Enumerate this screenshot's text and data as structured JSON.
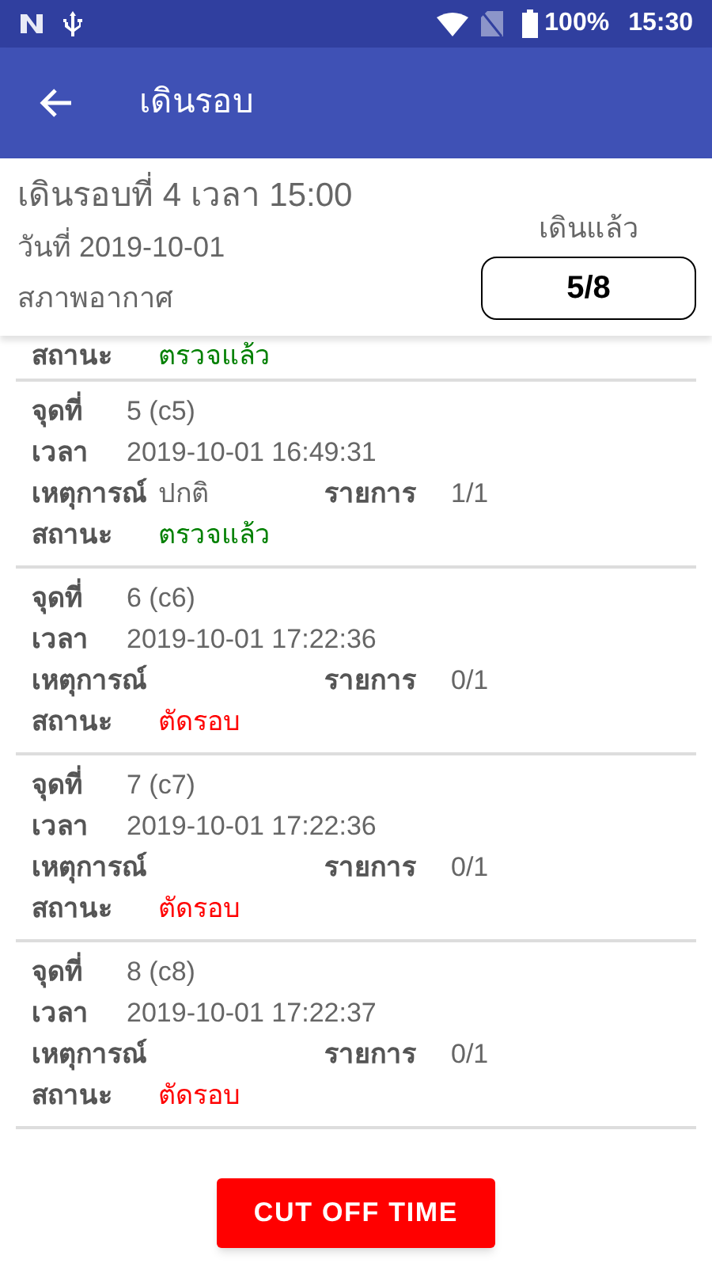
{
  "status_bar": {
    "battery": "100%",
    "time": "15:30"
  },
  "app_bar": {
    "title": "เดินรอบ"
  },
  "summary": {
    "round": "เดินรอบที่ 4 เวลา 15:00",
    "date": "วันที่ 2019-10-01",
    "weather": "สภาพอากาศ",
    "walked_label": "เดินแล้ว",
    "walked": "5/8"
  },
  "points": [
    {
      "status_label": "สถานะ",
      "status": "ตรวจแล้ว",
      "kind": "done"
    },
    {
      "point_label": "จุดที่",
      "point": "5 (c5)",
      "time_label": "เวลา",
      "time": "2019-10-01 16:49:31",
      "event_label": "เหตุการณ์",
      "event": "ปกติ",
      "items_label": "รายการ",
      "items": "1/1",
      "status_label": "สถานะ",
      "status": "ตรวจแล้ว",
      "kind": "done"
    },
    {
      "point_label": "จุดที่",
      "point": "6 (c6)",
      "time_label": "เวลา",
      "time": "2019-10-01 17:22:36",
      "event_label": "เหตุการณ์",
      "items_label": "รายการ",
      "items": "0/1",
      "status_label": "สถานะ",
      "status": "ตัดรอบ",
      "kind": "cut"
    },
    {
      "point_label": "จุดที่",
      "point": "7 (c7)",
      "time_label": "เวลา",
      "time": "2019-10-01 17:22:36",
      "event_label": "เหตุการณ์",
      "items_label": "รายการ",
      "items": "0/1",
      "status_label": "สถานะ",
      "status": "ตัดรอบ",
      "kind": "cut"
    },
    {
      "point_label": "จุดที่",
      "point": "8 (c8)",
      "time_label": "เวลา",
      "time": "2019-10-01 17:22:37",
      "event_label": "เหตุการณ์",
      "items_label": "รายการ",
      "items": "0/1",
      "status_label": "สถานะ",
      "status": "ตัดรอบ",
      "kind": "cut"
    }
  ],
  "button": {
    "label": "CUT OFF TIME"
  }
}
